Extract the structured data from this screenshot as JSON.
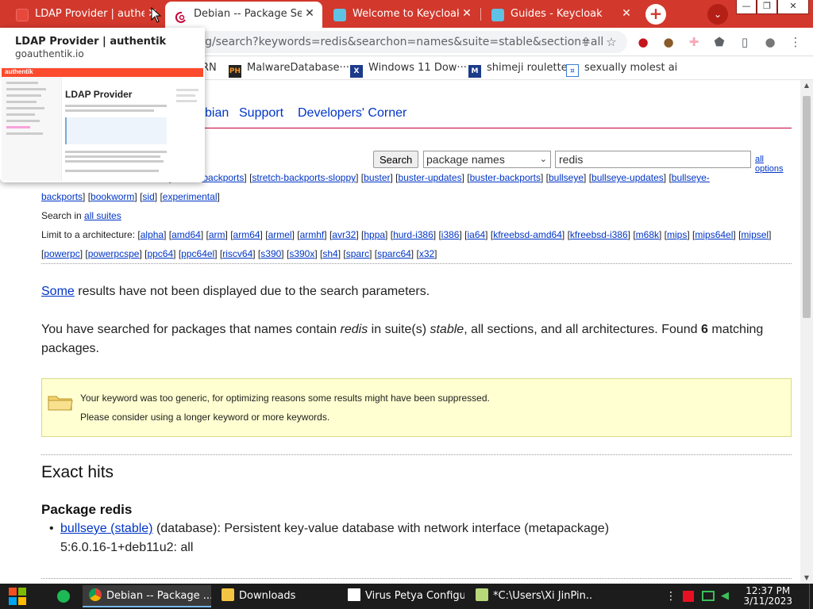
{
  "browser": {
    "tabs": [
      {
        "title": "LDAP Provider | authentik",
        "close": "✕"
      },
      {
        "title": "Debian -- Package Search Results",
        "close": "✕"
      },
      {
        "title": "Welcome to Keycloak",
        "close": "✕"
      },
      {
        "title": "Guides - Keycloak",
        "close": "✕"
      }
    ],
    "new_tab": "+",
    "tab_search": "⌄",
    "window_buttons": {
      "minimize": "—",
      "maximize": "❐",
      "close": "✕"
    },
    "url": "org/search?keywords=redis&searchon=names&suite=stable&section=all",
    "toolbar_icons": {
      "share": "⇪",
      "star": "☆",
      "ext1": "●",
      "ext2": "●",
      "ext3": "✚",
      "puzzle": "⬟",
      "sidepanel": "▯",
      "profile": "●",
      "menu": "⋮"
    },
    "bookmarks": [
      {
        "label": "RN",
        "icon": ""
      },
      {
        "label": "MalwareDatabase···",
        "icon": "PH"
      },
      {
        "label": "Windows 11 Dow···",
        "icon": "X"
      },
      {
        "label": "shimeji roulette",
        "icon": "M"
      },
      {
        "label": "sexually molest ai",
        "icon": "¤"
      }
    ]
  },
  "preview": {
    "title": "LDAP Provider | authentik",
    "domain": "goauthentik.io",
    "thumb_brand": "authentik",
    "thumb_heading": "LDAP Provider"
  },
  "page": {
    "nav": {
      "partial": "bian",
      "support": "Support",
      "developers": "Developers' Corner"
    },
    "search": {
      "button": "Search",
      "scope": "package names",
      "keyword": "redis",
      "all_options": "all options"
    },
    "suites_line1": [
      "stretch-backports",
      "stretch-backports-sloppy",
      "buster",
      "buster-updates",
      "buster-backports",
      "bullseye",
      "bullseye-updates",
      "bullseye-"
    ],
    "suites_line2": [
      "backports",
      "bookworm",
      "sid",
      "experimental"
    ],
    "search_in_label": "Search in",
    "search_in_link": "all suites",
    "arch_label": "Limit to a architecture:",
    "arch_line1": [
      "alpha",
      "amd64",
      "arm",
      "arm64",
      "armel",
      "armhf",
      "avr32",
      "hppa",
      "hurd-i386",
      "i386",
      "ia64",
      "kfreebsd-amd64",
      "kfreebsd-i386",
      "m68k",
      "mips",
      "mips64el",
      "mipsel"
    ],
    "arch_line2": [
      "powerpc",
      "powerpcspe",
      "ppc64",
      "ppc64el",
      "riscv64",
      "s390",
      "s390x",
      "sh4",
      "sparc",
      "sparc64",
      "x32"
    ],
    "some_link": "Some",
    "some_rest": " results have not been displayed due to the search parameters.",
    "searched_1": "You have searched for packages that names contain ",
    "searched_kw": "redis",
    "searched_2": " in suite(s) ",
    "searched_suite": "stable",
    "searched_3": ", all sections, and all architectures. Found ",
    "searched_count": "6",
    "searched_4": " matching",
    "searched_line2": "packages.",
    "notice_line1": "Your keyword was too generic, for optimizing reasons some results might have been suppressed.",
    "notice_line2": "Please consider using a longer keyword or more keywords.",
    "exact_hits": "Exact hits",
    "package_heading": "Package redis",
    "result_link": "bullseye (stable)",
    "result_desc": " (database): Persistent key-value database with network interface (metapackage)",
    "result_version": "5:6.0.16-1+deb11u2: all"
  },
  "taskbar": {
    "items": [
      {
        "label": "Debian -- Package ..."
      },
      {
        "label": "Downloads"
      },
      {
        "label": "Virus Petya Configu..."
      },
      {
        "label": "*C:\\Users\\Xi JinPin..."
      }
    ],
    "time": "12:37 PM",
    "date": "3/11/2023"
  }
}
